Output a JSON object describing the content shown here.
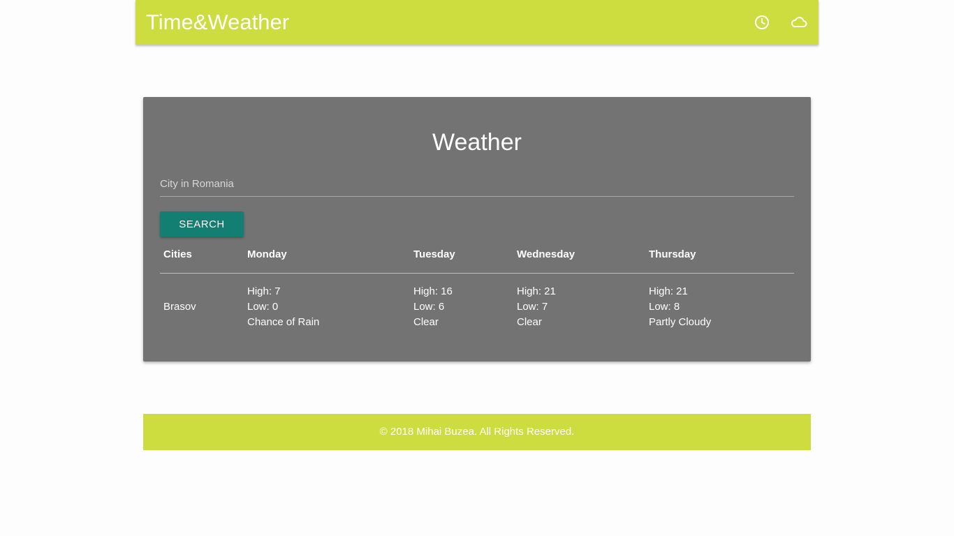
{
  "navbar": {
    "brand": "Time&Weather",
    "icons": [
      "clock-icon",
      "cloud-icon"
    ],
    "color": "#cddc3f"
  },
  "weather": {
    "title": "Weather",
    "search_placeholder": "City in Romania",
    "search_value": "",
    "search_button": "SEARCH",
    "button_color": "#137f73",
    "card_color": "#737373",
    "columns": [
      "Cities",
      "Monday",
      "Tuesday",
      "Wednesday",
      "Thursday"
    ],
    "rows": [
      {
        "city": "Brasov",
        "days": [
          {
            "high": "High: 7",
            "low": "Low: 0",
            "condition": "Chance of Rain"
          },
          {
            "high": "High: 16",
            "low": "Low: 6",
            "condition": "Clear"
          },
          {
            "high": "High: 21",
            "low": "Low: 7",
            "condition": "Clear"
          },
          {
            "high": "High: 21",
            "low": "Low: 8",
            "condition": "Partly Cloudy"
          }
        ]
      }
    ]
  },
  "footer": {
    "text": "© 2018 Mihai Buzea. All Rights Reserved."
  }
}
